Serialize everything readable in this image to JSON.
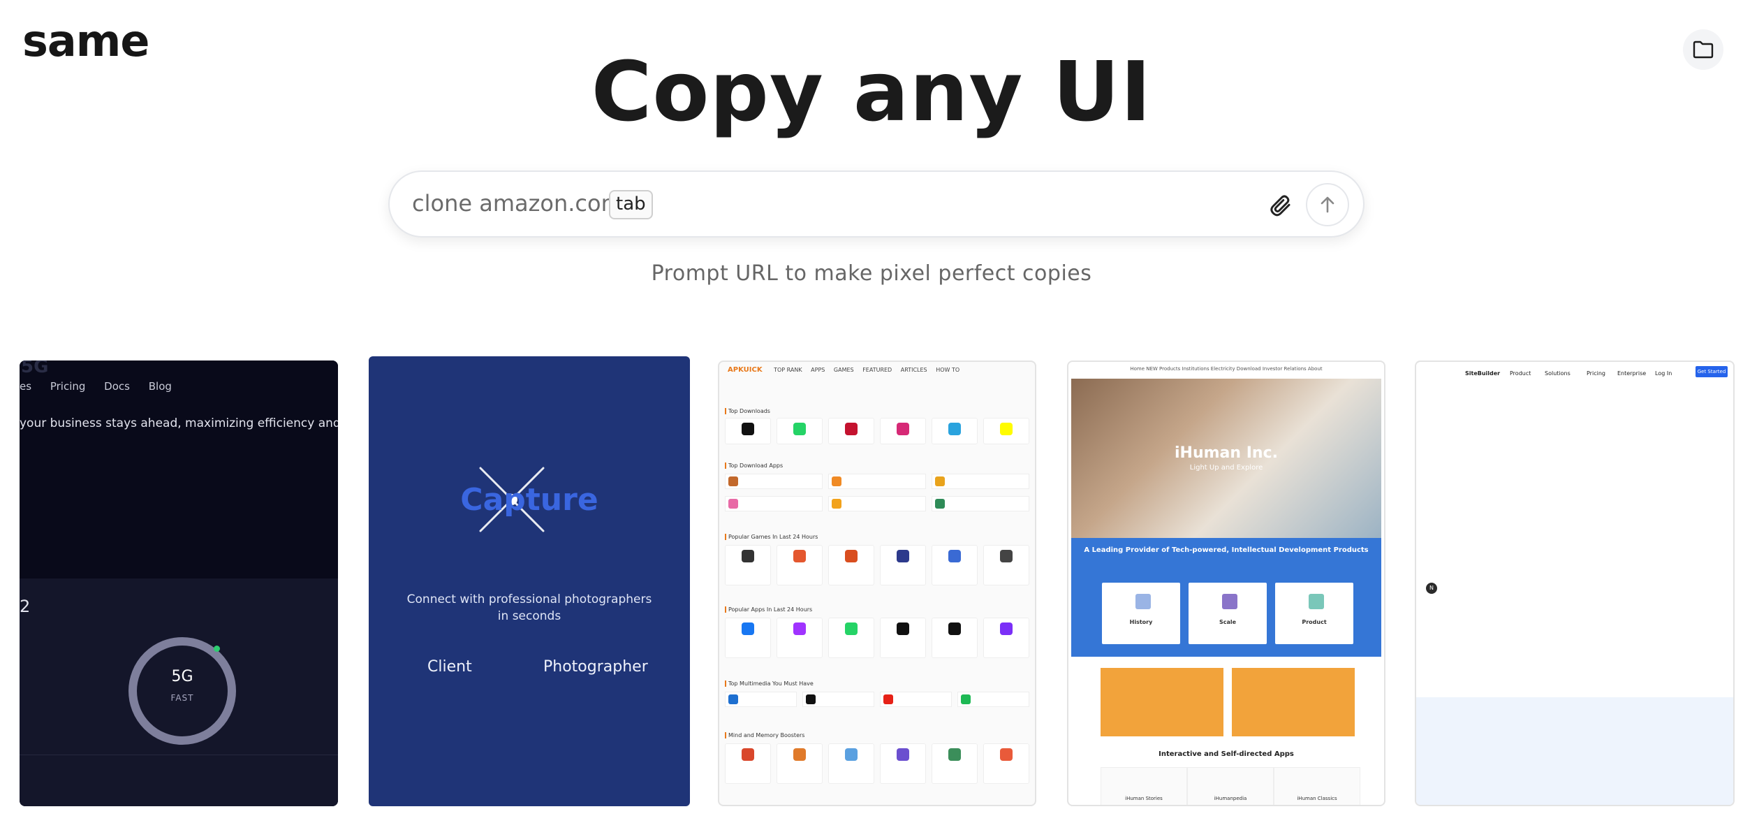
{
  "brand": {
    "logo": "same"
  },
  "header": {
    "folder_icon": "folder-icon"
  },
  "hero": {
    "headline": "Copy any UI",
    "prompt_placeholder": "clone amazon.com",
    "tab_hint": "tab",
    "subtitle": "Prompt URL to make pixel perfect copies"
  },
  "cards": {
    "card1": {
      "ghost_text": "5G",
      "nav": [
        "es",
        "Pricing",
        "Docs",
        "Blog"
      ],
      "tagline": "your business stays ahead, maximizing efficiency and product",
      "side_number": "2",
      "gauge_label": "5G",
      "gauge_sub": "FAST"
    },
    "card2": {
      "brand": "Capture",
      "connect": "Connect with professional photographers in seconds",
      "client": "Client",
      "photographer": "Photographer"
    },
    "card3": {
      "logo": "APKUICK",
      "nav": [
        "TOP RANK",
        "APPS",
        "GAMES",
        "FEATURED",
        "ARTICLES",
        "HOW TO"
      ],
      "sections": [
        "Top Downloads",
        "Top Download Apps",
        "Popular Games In Last 24 Hours",
        "Popular Apps In Last 24 Hours",
        "Top Multimedia You Must Have",
        "Mind and Memory Boosters"
      ]
    },
    "card4": {
      "nav": "Home  NEW  Products  Institutions  Electricity  Download  Investor Relations  About",
      "hero_title": "iHuman Inc.",
      "hero_sub": "Light Up and Explore",
      "blue_title": "A Leading Provider of Tech-powered, Intellectual Development Products",
      "boxes": [
        "History",
        "Scale",
        "Product"
      ],
      "interactive": "Interactive and Self-directed Apps",
      "apps": [
        "iHuman Stories",
        "iHumanpedia",
        "iHuman Classics"
      ]
    },
    "card5": {
      "logo": "SiteBuilder",
      "nav": [
        "Product",
        "Solutions",
        "Pricing",
        "Enterprise",
        "Log In"
      ],
      "cta": "Get Started",
      "circle": "N"
    }
  },
  "colors": {
    "accent_dark": "#161616",
    "card2_bg": "#1f3477",
    "card4_blue": "#3576d6",
    "card4_orange": "#f2a33b",
    "card5_cta": "#2563eb"
  }
}
